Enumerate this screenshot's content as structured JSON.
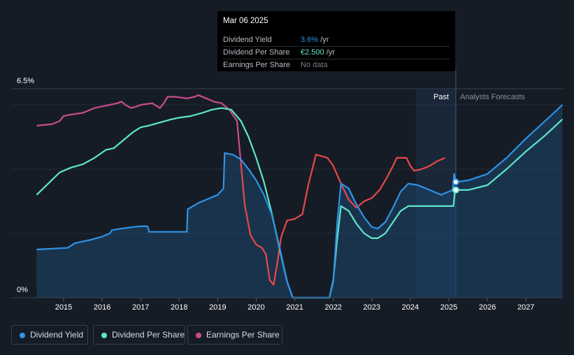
{
  "tooltip": {
    "date": "Mar 06 2025",
    "rows": [
      {
        "label": "Dividend Yield",
        "value": "3.6%",
        "unit": " /yr"
      },
      {
        "label": "Dividend Per Share",
        "value": "€2.500",
        "unit": " /yr"
      },
      {
        "label": "Earnings Per Share",
        "value": "No data",
        "unit": ""
      }
    ]
  },
  "regions": {
    "past": "Past",
    "forecast": "Analysts Forecasts"
  },
  "legend": [
    {
      "label": "Dividend Yield",
      "color": "#2e93e6"
    },
    {
      "label": "Dividend Per Share",
      "color": "#5de8c8"
    },
    {
      "label": "Earnings Per Share",
      "color": "#c94c8e"
    }
  ],
  "colors": {
    "background": "#161c26",
    "forecast_shade": "#1c3652",
    "eps_low": "#e84848"
  },
  "chart_data": {
    "type": "line",
    "y_tick_labels": [
      "6.5%",
      "0%"
    ],
    "x_tick_labels": [
      "2015",
      "2016",
      "2017",
      "2018",
      "2019",
      "2020",
      "2021",
      "2022",
      "2023",
      "2024",
      "2025",
      "2026",
      "2027"
    ],
    "xlim": [
      2014.2,
      2027.95
    ],
    "ylim": [
      0,
      6.5
    ],
    "past_forecast_boundary": 2025.18,
    "grid": true,
    "legend_position": "bottom-left",
    "series": [
      {
        "name": "Dividend Yield",
        "color": "#2e93e6",
        "filled": true,
        "points": [
          [
            2014.3,
            1.5
          ],
          [
            2015.1,
            1.55
          ],
          [
            2015.3,
            1.7
          ],
          [
            2015.7,
            1.8
          ],
          [
            2016.0,
            1.9
          ],
          [
            2016.2,
            2.0
          ],
          [
            2016.25,
            2.1
          ],
          [
            2016.5,
            2.15
          ],
          [
            2016.8,
            2.2
          ],
          [
            2017.0,
            2.22
          ],
          [
            2017.18,
            2.22
          ],
          [
            2017.22,
            2.05
          ],
          [
            2018.2,
            2.05
          ],
          [
            2018.22,
            2.75
          ],
          [
            2018.5,
            2.95
          ],
          [
            2018.8,
            3.1
          ],
          [
            2019.0,
            3.2
          ],
          [
            2019.15,
            3.4
          ],
          [
            2019.18,
            4.5
          ],
          [
            2019.4,
            4.45
          ],
          [
            2019.6,
            4.3
          ],
          [
            2019.8,
            4.0
          ],
          [
            2020.0,
            3.65
          ],
          [
            2020.2,
            3.2
          ],
          [
            2020.4,
            2.6
          ],
          [
            2020.6,
            1.6
          ],
          [
            2020.8,
            0.5
          ],
          [
            2020.95,
            0
          ],
          [
            2021.9,
            0
          ],
          [
            2022.0,
            0.5
          ],
          [
            2022.1,
            2.3
          ],
          [
            2022.2,
            3.55
          ],
          [
            2022.4,
            3.4
          ],
          [
            2022.6,
            2.9
          ],
          [
            2022.8,
            2.5
          ],
          [
            2023.0,
            2.2
          ],
          [
            2023.15,
            2.15
          ],
          [
            2023.35,
            2.35
          ],
          [
            2023.55,
            2.8
          ],
          [
            2023.75,
            3.3
          ],
          [
            2023.95,
            3.55
          ],
          [
            2024.2,
            3.5
          ],
          [
            2024.5,
            3.35
          ],
          [
            2024.8,
            3.2
          ],
          [
            2025.0,
            3.3
          ],
          [
            2025.1,
            3.35
          ],
          [
            2025.14,
            3.85
          ],
          [
            2025.18,
            3.6
          ],
          [
            2025.5,
            3.65
          ],
          [
            2026.0,
            3.85
          ],
          [
            2026.5,
            4.35
          ],
          [
            2027.0,
            4.95
          ],
          [
            2027.5,
            5.5
          ],
          [
            2027.95,
            6.0
          ]
        ]
      },
      {
        "name": "Dividend Per Share",
        "color": "#5de8c8",
        "filled": false,
        "points": [
          [
            2014.3,
            3.2
          ],
          [
            2014.6,
            3.55
          ],
          [
            2014.9,
            3.9
          ],
          [
            2015.2,
            4.05
          ],
          [
            2015.5,
            4.15
          ],
          [
            2015.8,
            4.35
          ],
          [
            2016.1,
            4.6
          ],
          [
            2016.3,
            4.65
          ],
          [
            2016.5,
            4.85
          ],
          [
            2016.8,
            5.15
          ],
          [
            2017.0,
            5.3
          ],
          [
            2017.2,
            5.35
          ],
          [
            2017.5,
            5.45
          ],
          [
            2017.8,
            5.55
          ],
          [
            2018.0,
            5.6
          ],
          [
            2018.3,
            5.65
          ],
          [
            2018.6,
            5.75
          ],
          [
            2018.85,
            5.85
          ],
          [
            2019.1,
            5.9
          ],
          [
            2019.35,
            5.85
          ],
          [
            2019.6,
            5.5
          ],
          [
            2019.8,
            5.0
          ],
          [
            2020.0,
            4.35
          ],
          [
            2020.2,
            3.6
          ],
          [
            2020.4,
            2.65
          ],
          [
            2020.6,
            1.55
          ],
          [
            2020.8,
            0.5
          ],
          [
            2020.95,
            0
          ],
          [
            2021.9,
            0
          ],
          [
            2022.0,
            0.55
          ],
          [
            2022.1,
            1.8
          ],
          [
            2022.2,
            2.85
          ],
          [
            2022.4,
            2.7
          ],
          [
            2022.6,
            2.3
          ],
          [
            2022.8,
            2.0
          ],
          [
            2023.0,
            1.85
          ],
          [
            2023.15,
            1.85
          ],
          [
            2023.35,
            2.0
          ],
          [
            2023.55,
            2.35
          ],
          [
            2023.75,
            2.7
          ],
          [
            2023.95,
            2.85
          ],
          [
            2024.0,
            2.85
          ],
          [
            2025.12,
            2.85
          ],
          [
            2025.16,
            3.35
          ],
          [
            2025.5,
            3.35
          ],
          [
            2026.0,
            3.5
          ],
          [
            2026.5,
            4.0
          ],
          [
            2027.0,
            4.55
          ],
          [
            2027.5,
            5.05
          ],
          [
            2027.95,
            5.55
          ]
        ]
      },
      {
        "name": "Earnings Per Share",
        "color": "#c94c8e",
        "filled": false,
        "points": [
          [
            2014.3,
            5.35
          ],
          [
            2014.7,
            5.4
          ],
          [
            2014.9,
            5.5
          ],
          [
            2015.0,
            5.65
          ],
          [
            2015.2,
            5.7
          ],
          [
            2015.5,
            5.75
          ],
          [
            2015.8,
            5.9
          ],
          [
            2016.0,
            5.95
          ],
          [
            2016.2,
            6.0
          ],
          [
            2016.4,
            6.05
          ],
          [
            2016.5,
            6.1
          ],
          [
            2016.6,
            6.0
          ],
          [
            2016.75,
            5.9
          ],
          [
            2016.9,
            5.95
          ],
          [
            2017.0,
            6.0
          ],
          [
            2017.3,
            6.05
          ],
          [
            2017.5,
            5.9
          ],
          [
            2017.6,
            6.05
          ],
          [
            2017.7,
            6.25
          ],
          [
            2017.9,
            6.25
          ],
          [
            2018.2,
            6.2
          ],
          [
            2018.4,
            6.25
          ],
          [
            2018.5,
            6.3
          ],
          [
            2018.7,
            6.2
          ],
          [
            2018.9,
            6.1
          ],
          [
            2019.1,
            6.05
          ],
          [
            2019.3,
            5.85
          ],
          [
            2019.5,
            5.5
          ],
          [
            2019.6,
            4.2
          ],
          [
            2019.7,
            2.9
          ],
          [
            2019.85,
            1.95
          ],
          [
            2020.0,
            1.65
          ],
          [
            2020.15,
            1.55
          ],
          [
            2020.25,
            1.35
          ],
          [
            2020.35,
            0.55
          ],
          [
            2020.45,
            0.4
          ],
          [
            2020.55,
            1.1
          ],
          [
            2020.65,
            1.9
          ],
          [
            2020.8,
            2.4
          ],
          [
            2021.0,
            2.45
          ],
          [
            2021.2,
            2.6
          ],
          [
            2021.35,
            3.5
          ],
          [
            2021.55,
            4.45
          ],
          [
            2021.7,
            4.4
          ],
          [
            2021.85,
            4.35
          ],
          [
            2022.0,
            4.1
          ],
          [
            2022.2,
            3.55
          ],
          [
            2022.4,
            3.05
          ],
          [
            2022.6,
            2.8
          ],
          [
            2022.8,
            3.0
          ],
          [
            2023.0,
            3.1
          ],
          [
            2023.2,
            3.35
          ],
          [
            2023.4,
            3.75
          ],
          [
            2023.55,
            4.1
          ],
          [
            2023.65,
            4.35
          ],
          [
            2023.9,
            4.35
          ],
          [
            2024.0,
            4.1
          ],
          [
            2024.1,
            3.95
          ],
          [
            2024.3,
            4.0
          ],
          [
            2024.5,
            4.1
          ],
          [
            2024.7,
            4.25
          ],
          [
            2024.9,
            4.35
          ]
        ]
      }
    ]
  }
}
